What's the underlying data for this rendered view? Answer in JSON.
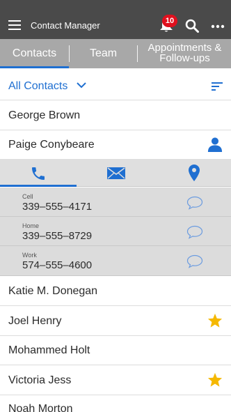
{
  "app_bar": {
    "title": "Contact Manager",
    "menu_icon": "hamburger-menu-icon",
    "notifications_icon": "bell-icon",
    "notification_count": "10",
    "search_icon": "search-icon",
    "more_icon": "more-horizontal-icon",
    "background_color": "#4a4a4a",
    "badge_color": "#e0101e"
  },
  "tabs": [
    {
      "label": "Contacts",
      "active": true
    },
    {
      "label": "Team",
      "active": false
    },
    {
      "label": "Appointments & Follow-ups",
      "active": false
    }
  ],
  "filter": {
    "label": "All Contacts",
    "dropdown_icon": "chevron-down-icon",
    "sort_icon": "sort-icon"
  },
  "accent_color": "#1f6fd1",
  "contacts": [
    {
      "name": "George Brown",
      "icon": ""
    },
    {
      "name": "Paige Conybeare",
      "icon": "person-icon",
      "expanded": true
    },
    {
      "name": "Katie M. Donegan",
      "icon": ""
    },
    {
      "name": "Joel Henry",
      "icon": "star-icon"
    },
    {
      "name": "Mohammed Holt",
      "icon": ""
    },
    {
      "name": "Victoria Jess",
      "icon": "star-icon"
    },
    {
      "name": "Noah Morton",
      "icon": ""
    }
  ],
  "expanded_contact": {
    "action_tabs": [
      {
        "icon": "phone-icon",
        "active": true
      },
      {
        "icon": "mail-icon",
        "active": false
      },
      {
        "icon": "location-pin-icon",
        "active": false
      }
    ],
    "phones": [
      {
        "label": "Cell",
        "number": "339–555–4171",
        "action_icon": "message-icon"
      },
      {
        "label": "Home",
        "number": "339–555–8729",
        "action_icon": "message-icon"
      },
      {
        "label": "Work",
        "number": "574–555–4600",
        "action_icon": "message-icon"
      }
    ]
  },
  "star_color": "#f5b800"
}
